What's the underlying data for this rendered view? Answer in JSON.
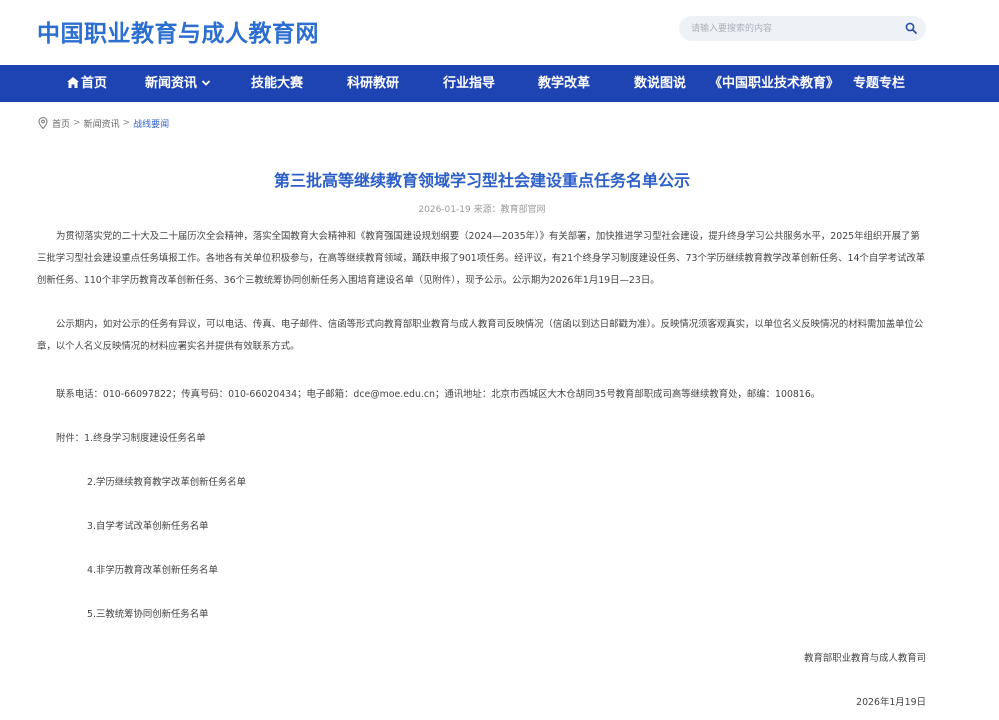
{
  "site": {
    "logo": "中国职业教育与成人教育网",
    "search_placeholder": "请输入要搜索的内容",
    "search_icon": "search-icon"
  },
  "nav": {
    "items": [
      {
        "label": "首页",
        "icon": "home-icon"
      },
      {
        "label": "新闻资讯",
        "icon": "chevron-down-icon"
      },
      {
        "label": "技能大赛"
      },
      {
        "label": "科研教研"
      },
      {
        "label": "行业指导"
      },
      {
        "label": "教学改革"
      },
      {
        "label": "数说图说"
      },
      {
        "label": "《中国职业技术教育》"
      },
      {
        "label": "专题专栏"
      }
    ],
    "bg_color": "#1e44b4"
  },
  "breadcrumb": {
    "icon": "location-pin-icon",
    "items": [
      "首页",
      "新闻资讯",
      "战线要闻"
    ],
    "separator": ">"
  },
  "article": {
    "title": "第三批高等继续教育领域学习型社会建设重点任务名单公示",
    "meta": "2026-01-19 来源：教育部官网",
    "paragraphs": [
      "为贯彻落实党的二十大及二十届历次全会精神，落实全国教育大会精神和《教育强国建设规划纲要（2024—2035年）》有关部署，加快推进学习型社会建设，提升终身学习公共服务水平，2025年组织开展了第三批学习型社会建设重点任务填报工作。各地各有关单位积极参与，在高等继续教育领域，踊跃申报了901项任务。经评议，有21个终身学习制度建设任务、73个学历继续教育教学改革创新任务、14个自学考试改革创新任务、110个非学历教育改革创新任务、36个三教统筹协同创新任务入围培育建设名单（见附件），现予公示。公示期为2026年1月19日—23日。",
      "公示期内，如对公示的任务有异议，可以电话、传真、电子邮件、信函等形式向教育部职业教育与成人教育司反映情况（信函以到达日邮戳为准）。反映情况须客观真实，以单位名义反映情况的材料需加盖单位公章，以个人名义反映情况的材料应署实名并提供有效联系方式。"
    ],
    "contact": "联系电话：010-66097822；传真号码：010-66020434；电子邮箱：dce@moe.edu.cn；通讯地址：北京市西城区大木仓胡同35号教育部职成司高等继续教育处，邮编：100816。",
    "attachments": [
      "附件：1.终身学习制度建设任务名单",
      "2.学历继续教育教学改革创新任务名单",
      "3.自学考试改革创新任务名单",
      "4.非学历教育改革创新任务名单",
      "5.三教统筹协同创新任务名单"
    ],
    "signature": "教育部职业教育与成人教育司",
    "date": "2026年1月19日"
  },
  "colors": {
    "accent": "#2c5fc9",
    "logo": "#2c6fd1"
  }
}
